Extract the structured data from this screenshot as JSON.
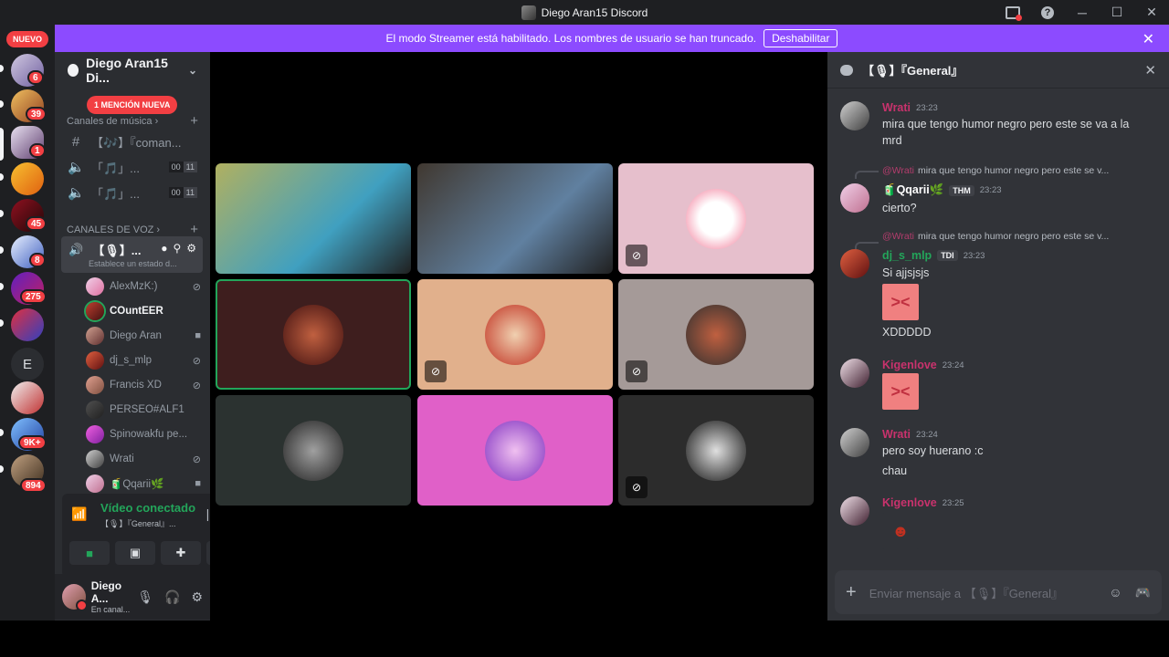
{
  "window": {
    "title": "Diego Aran15 Discord"
  },
  "banner": {
    "text": "El modo Streamer está habilitado. Los nombres de usuario se han truncado.",
    "button": "Deshabilitar"
  },
  "rail": {
    "nuevo": "NUEVO",
    "badges": [
      "6",
      "39",
      "1",
      "45",
      "8",
      "275",
      "9K+",
      "894"
    ],
    "letter_server": "E"
  },
  "sidebar": {
    "server_name": "Diego Aran15 Di...",
    "mention_pill": "1 MENCIÓN NUEVA",
    "music_category": "Canales de música",
    "voice_category": "CANALES DE VOZ",
    "text_channels": [
      {
        "name": "【🎶】『coman..."
      }
    ],
    "music_channels": [
      {
        "name": "「🎵」...",
        "count": "00",
        "limit": "11"
      },
      {
        "name": "「🎵」...",
        "count": "00",
        "limit": "11"
      }
    ],
    "active_channel": {
      "name": "【🎙】...",
      "status": "Establece un estado d..."
    },
    "voice_users": [
      {
        "name": "AlexMzK:)"
      },
      {
        "name": "COuntEER"
      },
      {
        "name": "Diego Aran"
      },
      {
        "name": "dj_s_mlp"
      },
      {
        "name": "Francis XD"
      },
      {
        "name": "PERSEO#ALF1"
      },
      {
        "name": "Spinowakfu pe..."
      },
      {
        "name": "Wrati"
      },
      {
        "name": "🧃Qqarii🌿"
      }
    ]
  },
  "voice_panel": {
    "status": "Vídeo conectado",
    "channel": "【🎙】『General』..."
  },
  "user": {
    "name": "Diego A...",
    "status": "En canal..."
  },
  "chat": {
    "channel": "【🎙】『General』",
    "placeholder": "Enviar mensaje a 【🎙】『General』",
    "messages": [
      {
        "author": "Wrati",
        "time": "23:23",
        "text": "mira que tengo humor negro pero este se va a la mrd"
      },
      {
        "reply_author": "@Wrati",
        "reply_text": "mira que tengo humor negro pero este se v...",
        "author": "🧃Qqarii🌿",
        "tag": "THM",
        "time": "23:23",
        "text": "cierto?"
      },
      {
        "reply_author": "@Wrati",
        "reply_text": "mira que tengo humor negro pero este se v...",
        "author": "dj_s_mlp",
        "tag": "TDI",
        "time": "23:23",
        "text": "Si ajjsjsjs",
        "text2": "XDDDDD"
      },
      {
        "author": "Kigenlove",
        "time": "23:24"
      },
      {
        "author": "Wrati",
        "time": "23:24",
        "text": "pero soy huerano :c",
        "text2": "chau"
      },
      {
        "author": "Kigenlove",
        "time": "23:25"
      }
    ]
  },
  "colors": {
    "accent": "#8c4bff",
    "online": "#23a55a",
    "danger": "#f23f43",
    "wrati": "#c9326d",
    "qqarii": "#ffffff",
    "djs": "#23a55a",
    "kigen": "#c9326d"
  }
}
